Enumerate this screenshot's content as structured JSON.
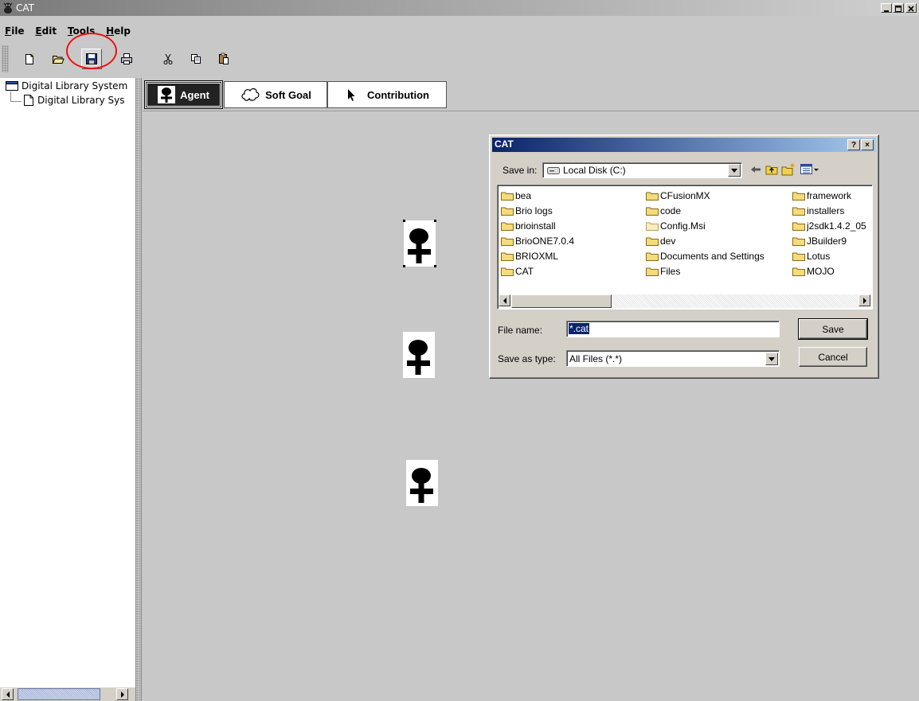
{
  "window": {
    "title": "CAT",
    "controls": {
      "minimize": "_",
      "maximize": "□",
      "close": "×"
    }
  },
  "menubar": {
    "items": [
      {
        "label": "File",
        "mnemonic": "F",
        "rest": "ile"
      },
      {
        "label": "Edit",
        "mnemonic": "E",
        "rest": "dit"
      },
      {
        "label": "Tools",
        "mnemonic": "T",
        "rest": "ools"
      },
      {
        "label": "Help",
        "mnemonic": "H",
        "rest": "elp"
      }
    ]
  },
  "toolbar": {
    "buttons": [
      "new-icon",
      "open-icon",
      "save-icon",
      "print-icon",
      "cut-icon",
      "copy-icon",
      "paste-icon"
    ],
    "highlighted": "save-icon",
    "highlight_color": "#ee1111"
  },
  "tree": {
    "root": "Digital Library System",
    "child": "Digital Library Sys"
  },
  "palette": {
    "tabs": [
      {
        "label": "Agent",
        "icon": "agent-icon",
        "selected": true
      },
      {
        "label": "Soft Goal",
        "icon": "cloud-icon",
        "selected": false
      },
      {
        "label": "Contribution",
        "icon": "arrow-cursor-icon",
        "selected": false
      }
    ]
  },
  "canvas": {
    "nodes": [
      {
        "type": "agent",
        "selected": true
      },
      {
        "type": "agent",
        "selected": false
      },
      {
        "type": "agent",
        "selected": false
      }
    ]
  },
  "dialog": {
    "title": "CAT",
    "help_button": "?",
    "close_button": "×",
    "save_in_label": "Save in:",
    "save_in_value": "Local Disk (C:)",
    "files": [
      [
        "bea",
        "Brio logs",
        "brioinstall",
        "BrioONE7.0.4",
        "BRIOXML",
        "CAT"
      ],
      [
        "CFusionMX",
        "code",
        "Config.Msi",
        "dev",
        "Documents and Settings",
        "Files"
      ],
      [
        "framework",
        "installers",
        "j2sdk1.4.2_05",
        "JBuilder9",
        "Lotus",
        "MOJO"
      ]
    ],
    "file_name_label": "File name:",
    "file_name_value": "*.cat",
    "save_as_type_label": "Save as type:",
    "save_as_type_value": "All Files (*.*)",
    "save_button": "Save",
    "cancel_button": "Cancel",
    "title_gradient": [
      "#0a246a",
      "#a6caf0"
    ]
  }
}
